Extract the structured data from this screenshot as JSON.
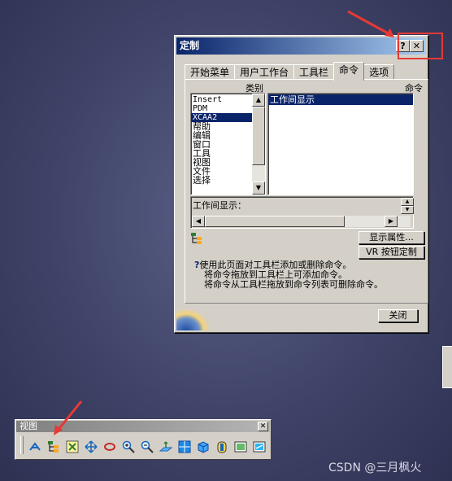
{
  "dialog": {
    "title": "定制",
    "help_btn": "?",
    "close_btn": "✕",
    "tabs": [
      "开始菜单",
      "用户工作台",
      "工具栏",
      "命令",
      "选项"
    ],
    "active_tab": "命令",
    "category_label": "类别",
    "command_label": "命令",
    "categories": [
      "Insert",
      "PDM",
      "XCAA2",
      "帮助",
      "编辑",
      "窗口",
      "工具",
      "视图",
      "文件",
      "选择"
    ],
    "selected_category": "XCAA2",
    "commands": [
      "工作间显示"
    ],
    "selected_command": "工作间显示",
    "desc_label": "工作间显示：",
    "show_props_btn": "显示属性...",
    "vr_btn": "VR 按钮定制",
    "help_lines": [
      "使用此页面对工具栏添加或删除命令。",
      "将命令拖放到工具栏上可添加命令。",
      "将命令从工具栏拖放到命令列表可删除命令。"
    ],
    "close_label": "关闭"
  },
  "toolbar": {
    "title": "视图",
    "close": "✕",
    "icons": [
      "fly-mode-icon",
      "spec-tree-icon",
      "fit-all-icon",
      "pan-icon",
      "rotate-icon",
      "zoom-in-icon",
      "zoom-out-icon",
      "normal-view-icon",
      "multi-view-icon",
      "iso-view-icon",
      "render-style-icon",
      "hide-show-icon",
      "swap-visible-icon"
    ]
  },
  "watermark": "CSDN @三月枫火",
  "colors": {
    "highlight": "#0a246a",
    "annotation_red": "#e53935"
  }
}
